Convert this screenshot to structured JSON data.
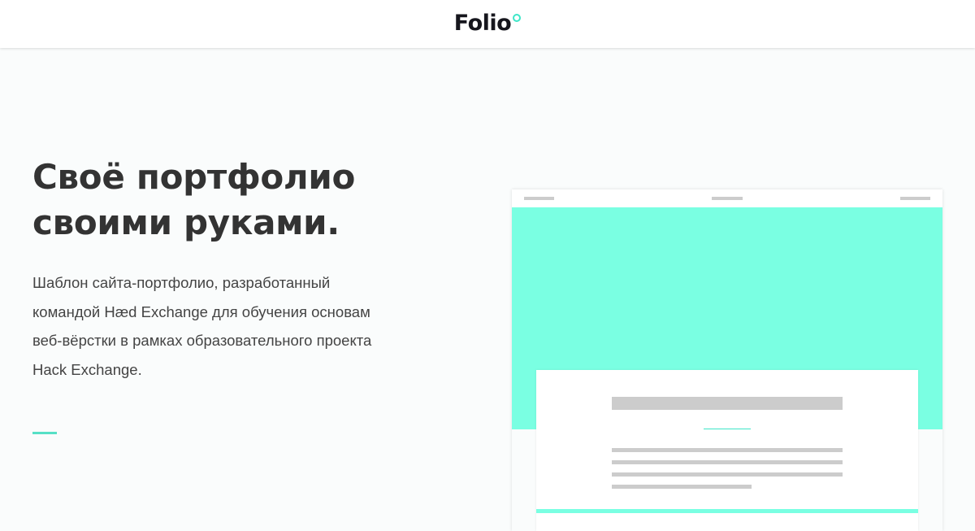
{
  "header": {
    "logo": "Folio"
  },
  "hero": {
    "headline_line1": "Своё портфолио",
    "headline_line2": "своими руками.",
    "description_line1": "Шаблон сайта-портфолио, разработанный",
    "description_line2": "командой Hæd Exchange для обучения основам",
    "description_line3": "веб-вёрстки в рамках образовательного проекта",
    "description_line4": "Hack Exchange."
  },
  "colors": {
    "accent": "#3ee6c8",
    "mockup_hero": "#7affe2",
    "text": "#333333",
    "placeholder": "#cccccc"
  },
  "icons": {
    "logo_mark": "ring-dot-icon"
  }
}
